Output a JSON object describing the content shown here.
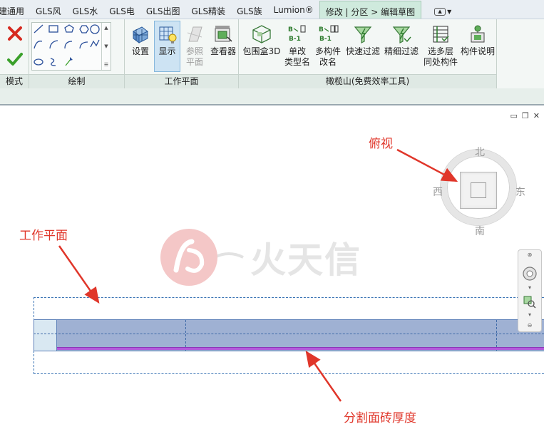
{
  "tabs": [
    "建通用",
    "GLS风",
    "GLS水",
    "GLS电",
    "GLS出图",
    "GLS精装",
    "GLS族",
    "Lumion®",
    "修改 | 分区 > 编辑草图"
  ],
  "active_tab_index": 8,
  "ribbon": {
    "mode_group": {
      "label": "模式"
    },
    "draw_group": {
      "label": "绘制"
    },
    "workplane_group": {
      "label": "工作平面",
      "buttons": [
        {
          "line1": "设置",
          "line2": ""
        },
        {
          "line1": "显示",
          "line2": ""
        },
        {
          "line1": "参照",
          "line2": "平面"
        },
        {
          "line1": "查看器",
          "line2": ""
        }
      ]
    },
    "gls_group": {
      "label": "橄榄山(免费效率工具)",
      "buttons": [
        {
          "line1": "包围盒3D",
          "line2": ""
        },
        {
          "line1": "单改",
          "line2": "类型名"
        },
        {
          "line1": "多构件",
          "line2": "改名"
        },
        {
          "line1": "快速过滤",
          "line2": ""
        },
        {
          "line1": "精细过滤",
          "line2": ""
        },
        {
          "line1": "选多层",
          "line2": "同处构件"
        },
        {
          "line1": "构件说明",
          "line2": ""
        }
      ],
      "icon_text_b1": "B-1"
    }
  },
  "viewcube": {
    "north": "北",
    "south": "南",
    "east": "东",
    "west": "西"
  },
  "annotations": {
    "top_view": "俯视",
    "work_plane": "工作平面",
    "tile_thickness": "分割面砖厚度"
  },
  "watermark": {
    "text": "火天信"
  },
  "colors": {
    "active_tab": "#cfeadd",
    "annotation_red": "#e0362a",
    "floor_band": "#9fb1d3",
    "tile_line_purple": "#b45adc",
    "workplane_dash": "#3b74b5"
  }
}
